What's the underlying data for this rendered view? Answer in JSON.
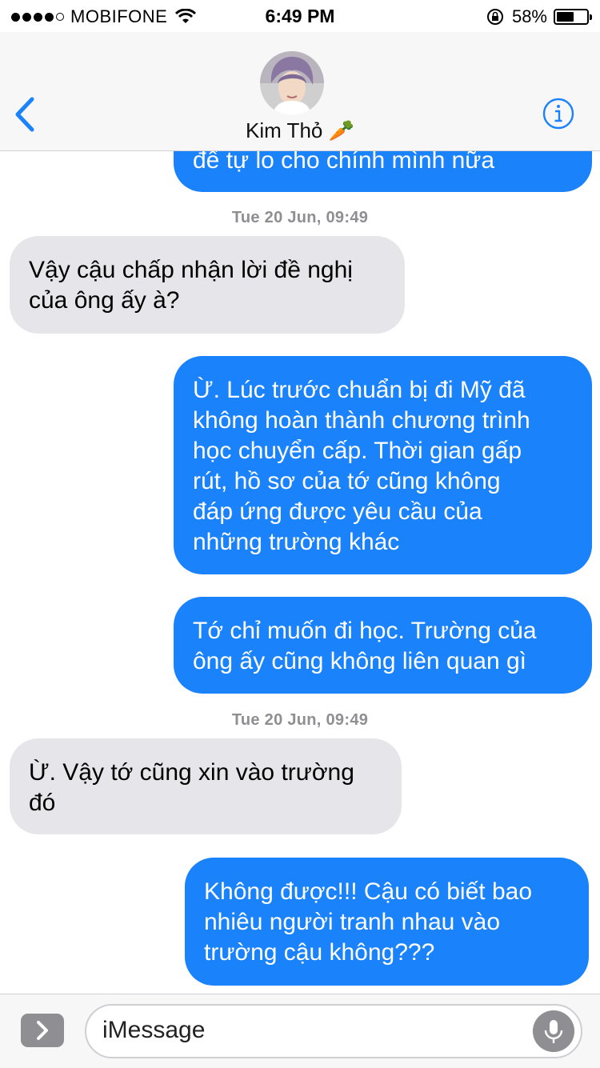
{
  "status": {
    "carrier": "MOBIFONE",
    "time": "6:49 PM",
    "battery_text": "58%",
    "battery_level": 0.58,
    "signal_bars": 4,
    "signal_icon": "signal-dots-icon",
    "wifi_icon": "wifi-icon",
    "rotation_lock_icon": "rotation-lock-icon"
  },
  "header": {
    "contact_name": "Kim Thỏ 🥕",
    "back_icon": "chevron-left-icon",
    "info_icon": "info-circle-icon"
  },
  "messages": {
    "partial": {
      "text": "để tự lo cho chính mình nữa"
    },
    "stamp1": "Tue 20 Jun, 09:49",
    "m1": {
      "text": "Vậy cậu chấp nhận lời đề nghị\ncủa ông ấy à?"
    },
    "m2": {
      "text": "Ừ. Lúc trước chuẩn bị đi Mỹ đã\nkhông hoàn thành chương trình\nhọc chuyển cấp. Thời gian gấp\nrút, hồ sơ của tớ cũng không\nđáp ứng được yêu cầu của\nnhững trường khác"
    },
    "m3": {
      "text": "Tớ chỉ muốn đi học. Trường của\nông ấy cũng không liên quan gì"
    },
    "stamp2": "Tue 20 Jun, 09:49",
    "m4": {
      "text": "Ừ. Vậy tớ cũng xin vào trường\nđó"
    },
    "m5": {
      "text": "Không được!!! Cậu có biết bao\nnhiêu người tranh nhau vào\ntrường cậu không???"
    }
  },
  "compose": {
    "placeholder": "iMessage",
    "expand_icon": "chevron-right-icon",
    "mic_icon": "microphone-icon"
  },
  "colors": {
    "outgoing_bubble": "#1a82fb",
    "incoming_bubble": "#e6e5ea",
    "accent": "#1a82fb",
    "timestamp": "#8e8e93"
  }
}
